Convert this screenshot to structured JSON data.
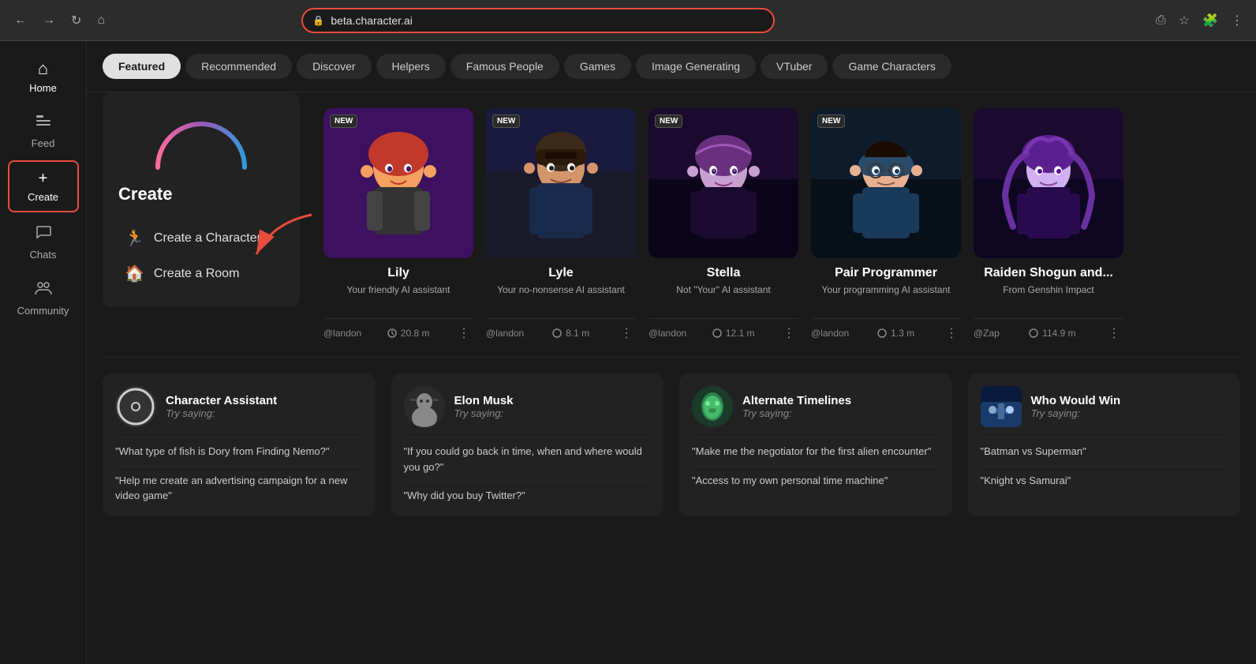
{
  "browser": {
    "url": "beta.character.ai",
    "lock_icon": "🔒"
  },
  "sidebar": {
    "items": [
      {
        "id": "home",
        "label": "Home",
        "icon": "⌂",
        "active": true
      },
      {
        "id": "feed",
        "label": "Feed",
        "icon": "≡",
        "active": false
      },
      {
        "id": "create",
        "label": "Create",
        "icon": "+",
        "active": true,
        "highlighted": true
      },
      {
        "id": "chats",
        "label": "Chats",
        "icon": "💬",
        "active": false
      },
      {
        "id": "community",
        "label": "Community",
        "icon": "👥",
        "active": false
      }
    ]
  },
  "tabs": [
    {
      "id": "featured",
      "label": "Featured",
      "active": true
    },
    {
      "id": "recommended",
      "label": "Recommended",
      "active": false
    },
    {
      "id": "discover",
      "label": "Discover",
      "active": false
    },
    {
      "id": "helpers",
      "label": "Helpers",
      "active": false
    },
    {
      "id": "famous",
      "label": "Famous People",
      "active": false
    },
    {
      "id": "games",
      "label": "Games",
      "active": false
    },
    {
      "id": "image",
      "label": "Image Generating",
      "active": false
    },
    {
      "id": "vtuber",
      "label": "VTuber",
      "active": false
    },
    {
      "id": "game-chars",
      "label": "Game Characters",
      "active": false
    }
  ],
  "create_panel": {
    "title": "Create",
    "options": [
      {
        "id": "character",
        "label": "Create a Character",
        "icon": "🏃"
      },
      {
        "id": "room",
        "label": "Create a Room",
        "icon": "🏠"
      }
    ]
  },
  "characters": [
    {
      "id": "lily",
      "name": "Lily",
      "description": "Your friendly AI assistant",
      "author": "@landon",
      "stats": "20.8 m",
      "is_new": true,
      "avatar_type": "lily"
    },
    {
      "id": "lyle",
      "name": "Lyle",
      "description": "Your no-nonsense AI assistant",
      "author": "@landon",
      "stats": "8.1 m",
      "is_new": true,
      "avatar_type": "lyle"
    },
    {
      "id": "stella",
      "name": "Stella",
      "description": "Not \"Your\" AI assistant",
      "author": "@landon",
      "stats": "12.1 m",
      "is_new": true,
      "avatar_type": "stella"
    },
    {
      "id": "pair",
      "name": "Pair Programmer",
      "description": "Your programming AI assistant",
      "author": "@landon",
      "stats": "1.3 m",
      "is_new": true,
      "avatar_type": "pair"
    },
    {
      "id": "raiden",
      "name": "Raiden Shogun and...",
      "description": "From Genshin Impact",
      "author": "@Zap",
      "stats": "114.9 m",
      "is_new": false,
      "avatar_type": "raiden"
    }
  ],
  "suggestions": [
    {
      "id": "character-assistant",
      "name": "Character Assistant",
      "try_label": "Try saying:",
      "avatar_type": "circle",
      "quotes": [
        "\"What type of fish is Dory from Finding Nemo?\"",
        "\"Help me create an advertising campaign for a new video game\""
      ]
    },
    {
      "id": "elon-musk",
      "name": "Elon Musk",
      "try_label": "Try saying:",
      "avatar_type": "person",
      "quotes": [
        "\"If you could go back in time, when and where would you go?\"",
        "\"Why did you buy Twitter?\""
      ]
    },
    {
      "id": "alternate-timelines",
      "name": "Alternate Timelines",
      "try_label": "Try saying:",
      "avatar_type": "butterfly",
      "quotes": [
        "\"Make me the negotiator for the first alien encounter\"",
        "\"Access to my own personal time machine\""
      ]
    },
    {
      "id": "who-would-win",
      "name": "Who Would Win",
      "try_label": "Try saying:",
      "avatar_type": "battle",
      "quotes": [
        "\"Batman vs Superman\"",
        "\"Knight vs Samurai\""
      ]
    }
  ]
}
